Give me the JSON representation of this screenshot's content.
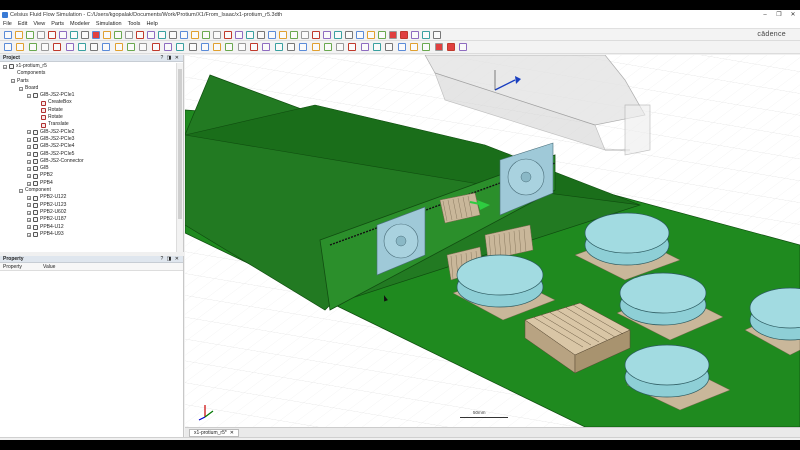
{
  "window": {
    "title": "Celsius Fluid Flow Simulation - C:/Users/kgopalak/Documents/Work/Protium/X1/From_Isaac/x1-protium_r5.3dth",
    "controls": [
      "–",
      "❐",
      "✕"
    ]
  },
  "menu": [
    "File",
    "Edit",
    "View",
    "Parts",
    "Modeler",
    "Simulation",
    "Tools",
    "Help"
  ],
  "brand": "cādence",
  "toolbar": {
    "icons_row1": [
      "new-file-icon",
      "open-icon",
      "save-icon",
      "cut-icon",
      "copy-icon",
      "paste-icon",
      "delete-icon",
      "undo-icon",
      "redo-icon",
      "select-icon",
      "move-icon",
      "rotate-icon",
      "scale-icon",
      "fit-view-icon",
      "zoom-in-icon",
      "zoom-out-icon",
      "pan-icon",
      "orbit-icon",
      "front-view-icon",
      "back-view-icon",
      "left-view-icon",
      "right-view-icon",
      "top-view-icon",
      "iso-view-icon",
      "arrow-left-icon",
      "arrow-right-icon",
      "arrow-up-icon",
      "arrow-down-icon",
      "grid-icon",
      "snap-icon",
      "wireframe-icon",
      "shaded-icon",
      "simulate-icon",
      "play-icon",
      "pause-icon",
      "stop-icon",
      "record-icon",
      "mesh-icon",
      "results-icon",
      "report-icon"
    ],
    "icons_row2": [
      "line-icon",
      "rectangle-icon",
      "circle-icon",
      "arc-icon",
      "polygon-icon",
      "box-icon",
      "cylinder-icon",
      "sphere-icon",
      "cone-icon",
      "torus-icon",
      "extrude-icon",
      "revolve-icon",
      "sweep-icon",
      "loft-icon",
      "fillet-icon",
      "chamfer-icon",
      "union-icon",
      "subtract-icon",
      "intersect-icon",
      "split-icon",
      "measure-icon",
      "dimension-icon",
      "align-icon",
      "mirror-icon",
      "pattern-icon",
      "array-icon",
      "hide-icon",
      "show-icon",
      "color-icon",
      "material-icon",
      "fan-icon",
      "heatsink-icon",
      "vent-icon",
      "monitor-icon",
      "probe-icon",
      "stop-red-icon",
      "record-red-icon",
      "settings-icon"
    ],
    "dropdown_value": "XY"
  },
  "project": {
    "title": "Project",
    "header_controls": "? ◨ ✕",
    "tree": [
      {
        "label": "x1-protium_r5",
        "level": 0,
        "expander": "−",
        "icon": "project"
      },
      {
        "label": "Components",
        "level": 1,
        "expander": "",
        "icon": ""
      },
      {
        "label": "Parts",
        "level": 1,
        "expander": "−",
        "icon": ""
      },
      {
        "label": "Board",
        "level": 2,
        "expander": "−",
        "icon": ""
      },
      {
        "label": "GIB-JS2-PCIe1",
        "level": 3,
        "expander": "−",
        "icon": "part"
      },
      {
        "label": "CreateBox",
        "level": 4,
        "expander": "",
        "icon": "op"
      },
      {
        "label": "Rotate",
        "level": 4,
        "expander": "",
        "icon": "op"
      },
      {
        "label": "Rotate",
        "level": 4,
        "expander": "",
        "icon": "op"
      },
      {
        "label": "Translate",
        "level": 4,
        "expander": "",
        "icon": "op"
      },
      {
        "label": "GIB-JS2-PCIe2",
        "level": 3,
        "expander": "+",
        "icon": "part"
      },
      {
        "label": "GIB-JS2-PCIe3",
        "level": 3,
        "expander": "+",
        "icon": "part"
      },
      {
        "label": "GIB-JS2-PCIe4",
        "level": 3,
        "expander": "+",
        "icon": "part"
      },
      {
        "label": "GIB-JS2-PCIe5",
        "level": 3,
        "expander": "+",
        "icon": "part"
      },
      {
        "label": "GIB-JS2-Connector",
        "level": 3,
        "expander": "+",
        "icon": "part"
      },
      {
        "label": "GIB",
        "level": 3,
        "expander": "+",
        "icon": "part"
      },
      {
        "label": "PPB2",
        "level": 3,
        "expander": "+",
        "icon": "part"
      },
      {
        "label": "PPB4",
        "level": 3,
        "expander": "+",
        "icon": "part"
      },
      {
        "label": "Component",
        "level": 2,
        "expander": "−",
        "icon": ""
      },
      {
        "label": "PPB2-U122",
        "level": 3,
        "expander": "+",
        "icon": "part"
      },
      {
        "label": "PPB2-U123",
        "level": 3,
        "expander": "+",
        "icon": "part"
      },
      {
        "label": "PPB2-U602",
        "level": 3,
        "expander": "+",
        "icon": "part"
      },
      {
        "label": "PPB2-U187",
        "level": 3,
        "expander": "+",
        "icon": "part"
      },
      {
        "label": "PPB4-U12",
        "level": 3,
        "expander": "+",
        "icon": "part"
      },
      {
        "label": "PPB4-U93",
        "level": 3,
        "expander": "+",
        "icon": "part"
      }
    ]
  },
  "property": {
    "title": "Property",
    "header_controls": "? ◨ ✕",
    "columns": [
      "Property",
      "Value"
    ]
  },
  "viewport": {
    "scale_label": "50mm",
    "colors": {
      "board": "#1f8a1f",
      "board_dark": "#176b17",
      "component": "#8ecfd6",
      "heatsink": "#c9b79a",
      "fan": "#9fc9d8"
    }
  },
  "doc_tab": {
    "label": "x1-protium_r5*",
    "close": "✕"
  },
  "status": {
    "unit": "mm"
  }
}
